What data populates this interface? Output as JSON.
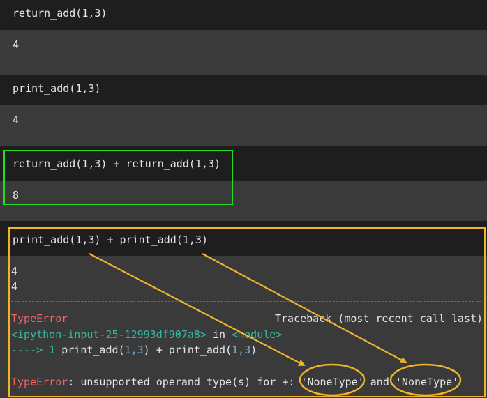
{
  "cells": [
    {
      "input": "return_add(1,3)",
      "output": "4"
    },
    {
      "input": "print_add(1,3)",
      "output": "4"
    },
    {
      "input": "return_add(1,3) + return_add(1,3)",
      "output": "8"
    },
    {
      "input": "print_add(1,3) + print_add(1,3)",
      "output_lines": [
        "4",
        "4"
      ]
    }
  ],
  "error": {
    "type": "TypeError",
    "traceback_label": "Traceback (most recent call last)",
    "location_prefix": "<ipython-input-25-12993df907a8>",
    "location_in": "in",
    "location_module": "<module>",
    "arrow": "---->",
    "line_no": "1",
    "code_a": "print_add(",
    "code_b": "1,3",
    "code_c": ") + print_add(",
    "code_d": "1,3",
    "code_e": ")",
    "message_prefix": "TypeError",
    "message": ": unsupported operand type(s) for +: ",
    "operand1": "'NoneType'",
    "and": "and",
    "operand2": "'NoneType'"
  },
  "colors": {
    "green_box": "#22dd22",
    "yellow_box": "#f0b429",
    "error_red": "#ee6666",
    "traceback_teal": "#35b8a0"
  }
}
